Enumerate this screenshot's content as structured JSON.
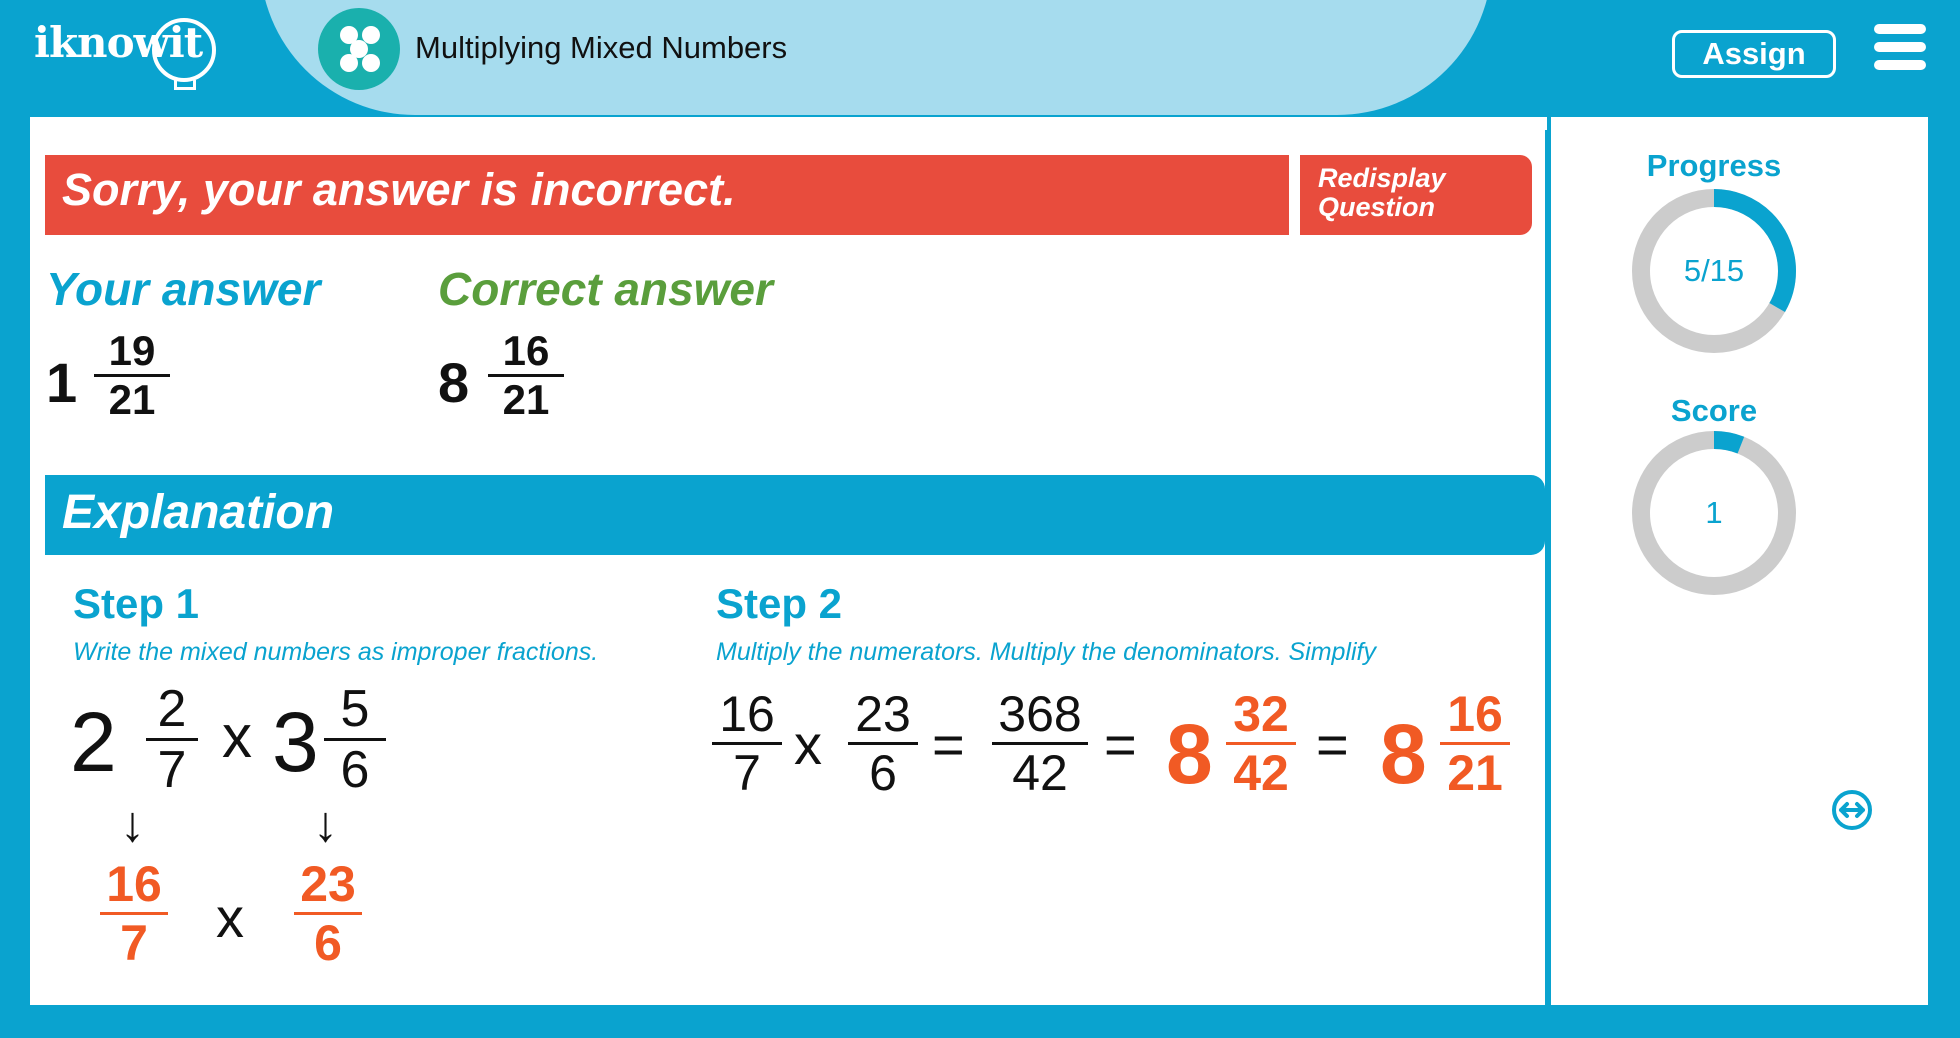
{
  "header": {
    "logo": "iknowit",
    "lesson_title": "Multiplying Mixed Numbers",
    "lesson_icon": "dots-circle-icon",
    "assign_label": "Assign",
    "menu_icon": "hamburger-menu-icon"
  },
  "feedback": {
    "message": "Sorry, your answer is incorrect.",
    "redisplay_label": "Redisplay\nQuestion",
    "your_answer_label": "Your answer",
    "correct_answer_label": "Correct answer",
    "your_answer": {
      "whole": "1",
      "numerator": "19",
      "denominator": "21"
    },
    "correct_answer": {
      "whole": "8",
      "numerator": "16",
      "denominator": "21"
    }
  },
  "explanation": {
    "title": "Explanation",
    "step1": {
      "title": "Step 1",
      "description": "Write the mixed numbers as improper fractions.",
      "mixed_a": {
        "whole": "2",
        "numerator": "2",
        "denominator": "7"
      },
      "mixed_b": {
        "whole": "3",
        "numerator": "5",
        "denominator": "6"
      },
      "times": "x",
      "improper_a": {
        "numerator": "16",
        "denominator": "7"
      },
      "improper_b": {
        "numerator": "23",
        "denominator": "6"
      },
      "arrow": "↓"
    },
    "step2": {
      "title": "Step 2",
      "description": "Multiply the numerators. Multiply the denominators. Simplify",
      "f1": {
        "numerator": "16",
        "denominator": "7"
      },
      "f2": {
        "numerator": "23",
        "denominator": "6"
      },
      "product": {
        "numerator": "368",
        "denominator": "42"
      },
      "mixed1": {
        "whole": "8",
        "numerator": "32",
        "denominator": "42"
      },
      "mixed2": {
        "whole": "8",
        "numerator": "16",
        "denominator": "21"
      },
      "times": "x",
      "equals": "="
    }
  },
  "sidebar": {
    "progress_label": "Progress",
    "progress_value": "5/15",
    "progress_fraction": 0.3333,
    "score_label": "Score",
    "score_value": "1",
    "score_fraction": 0.06,
    "swap_icon": "swap-arrows-icon"
  },
  "colors": {
    "brand_blue": "#0aa3cf",
    "incorrect_red": "#e84c3d",
    "correct_green": "#5a9e3c",
    "highlight_orange": "#f15a24",
    "ring_gray": "#cccccc"
  }
}
